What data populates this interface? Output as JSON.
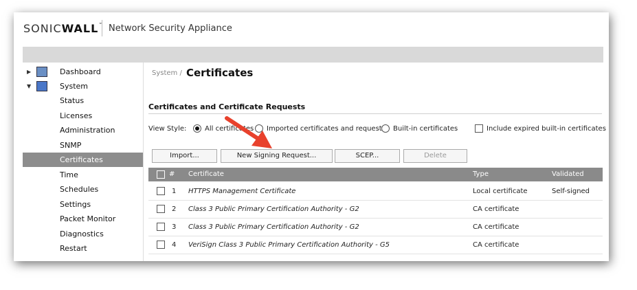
{
  "header": {
    "brand_light": "SONIC",
    "brand_bold": "WALL",
    "brand_tm": "™",
    "product": "Network Security Appliance"
  },
  "sidebar": {
    "items": [
      {
        "label": "Dashboard"
      },
      {
        "label": "System"
      },
      {
        "label": "Status"
      },
      {
        "label": "Licenses"
      },
      {
        "label": "Administration"
      },
      {
        "label": "SNMP"
      },
      {
        "label": "Certificates"
      },
      {
        "label": "Time"
      },
      {
        "label": "Schedules"
      },
      {
        "label": "Settings"
      },
      {
        "label": "Packet Monitor"
      },
      {
        "label": "Diagnostics"
      },
      {
        "label": "Restart"
      }
    ]
  },
  "breadcrumb": {
    "parent": "System /",
    "current": "Certificates"
  },
  "section": {
    "title": "Certificates and Certificate Requests"
  },
  "viewstyle": {
    "label": "View Style:",
    "options": [
      "All certificates",
      "Imported certificates and requests",
      "Built-in certificates"
    ],
    "selected": "All certificates",
    "include_expired": "Include expired built-in certificates"
  },
  "buttons": {
    "import": "Import...",
    "new_csr": "New Signing Request...",
    "scep": "SCEP...",
    "delete": "Delete"
  },
  "table": {
    "headers": {
      "num": "#",
      "certificate": "Certificate",
      "type": "Type",
      "validated": "Validated"
    },
    "rows": [
      {
        "num": "1",
        "certificate": "HTTPS Management Certificate",
        "type": "Local certificate",
        "validated": "Self-signed"
      },
      {
        "num": "2",
        "certificate": "Class 3 Public Primary Certification Authority - G2",
        "type": "CA certificate",
        "validated": ""
      },
      {
        "num": "3",
        "certificate": "Class 3 Public Primary Certification Authority - G2",
        "type": "CA certificate",
        "validated": ""
      },
      {
        "num": "4",
        "certificate": "VeriSign Class 3 Public Primary Certification Authority - G5",
        "type": "CA certificate",
        "validated": ""
      }
    ]
  },
  "colors": {
    "active_nav": "#8d8d8d",
    "table_header": "#8a8a8a",
    "arrow": "#e8412c"
  }
}
